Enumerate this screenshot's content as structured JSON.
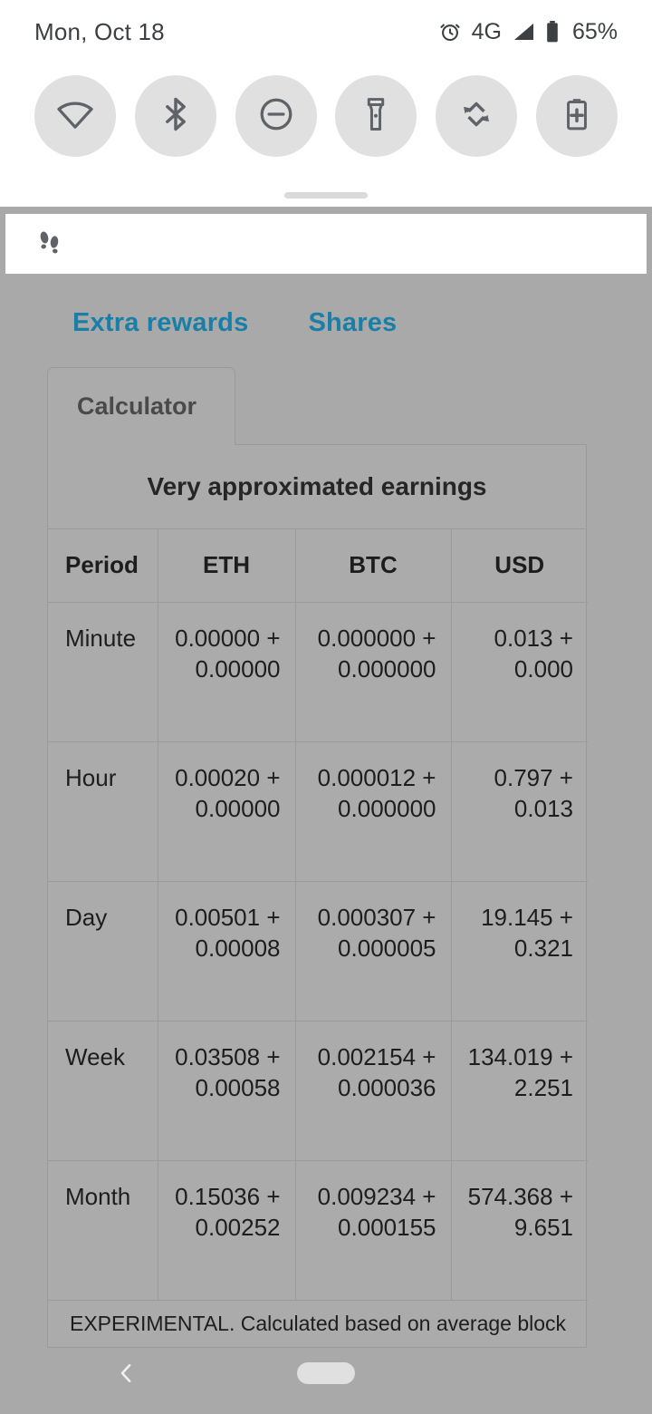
{
  "statusbar": {
    "date": "Mon, Oct 18",
    "alarm_icon": "alarm-icon",
    "network_label": "4G",
    "signal_icon": "signal-icon",
    "battery_icon": "battery-icon",
    "battery_percent": "65%"
  },
  "quick_settings": {
    "tiles": [
      {
        "name": "wifi-tile",
        "icon": "wifi-icon"
      },
      {
        "name": "bluetooth-tile",
        "icon": "bluetooth-icon"
      },
      {
        "name": "do-not-disturb-tile",
        "icon": "do-not-disturb-icon"
      },
      {
        "name": "flashlight-tile",
        "icon": "flashlight-icon"
      },
      {
        "name": "auto-rotate-tile",
        "icon": "auto-rotate-icon"
      },
      {
        "name": "battery-saver-tile",
        "icon": "battery-saver-icon"
      }
    ],
    "handle": "drag-handle"
  },
  "notification": {
    "icon": "footprints-icon"
  },
  "app": {
    "top_tabs": [
      {
        "label": "Extra rewards"
      },
      {
        "label": "Shares"
      }
    ],
    "link_color": "#1a7fa8",
    "calculator_tab": {
      "label": "Calculator"
    },
    "panel_title": "Very approximated earnings",
    "table": {
      "columns": [
        "Period",
        "ETH",
        "BTC",
        "USD"
      ],
      "rows": [
        {
          "period": "Minute",
          "eth": "0.00000 + 0.00000",
          "btc": "0.000000 + 0.000000",
          "usd": "0.013 + 0.000"
        },
        {
          "period": "Hour",
          "eth": "0.00020 + 0.00000",
          "btc": "0.000012 + 0.000000",
          "usd": "0.797 + 0.013"
        },
        {
          "period": "Day",
          "eth": "0.00501 + 0.00008",
          "btc": "0.000307 + 0.000005",
          "usd": "19.145 + 0.321"
        },
        {
          "period": "Week",
          "eth": "0.03508 + 0.00058",
          "btc": "0.002154 + 0.000036",
          "usd": "134.019 + 2.251"
        },
        {
          "period": "Month",
          "eth": "0.15036 + 0.00252",
          "btc": "0.009234 + 0.000155",
          "usd": "574.368 + 9.651"
        }
      ]
    },
    "footnote": "EXPERIMENTAL. Calculated based on average block"
  },
  "navbar": {
    "back_icon": "back-chevron-icon",
    "home_indicator": "home-pill-indicator"
  }
}
